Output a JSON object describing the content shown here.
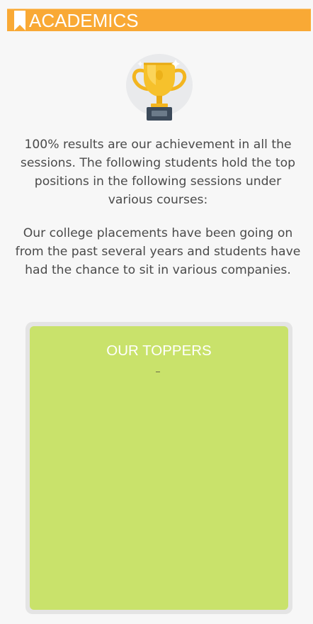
{
  "header": {
    "title": "ACADEMICS",
    "icon": "bookmark-icon",
    "background_color": "#f9a935"
  },
  "trophy": {
    "icon": "trophy-icon"
  },
  "content": {
    "paragraph_1": "100% results are our achievement in all the sessions. The following students hold the top positions in the following sessions under various courses:",
    "paragraph_2": "Our college placements have been going on from the past several years and students have had the chance to sit in various companies."
  },
  "toppers": {
    "title": "OUR TOPPERS",
    "panel_color": "#c9e26b"
  }
}
